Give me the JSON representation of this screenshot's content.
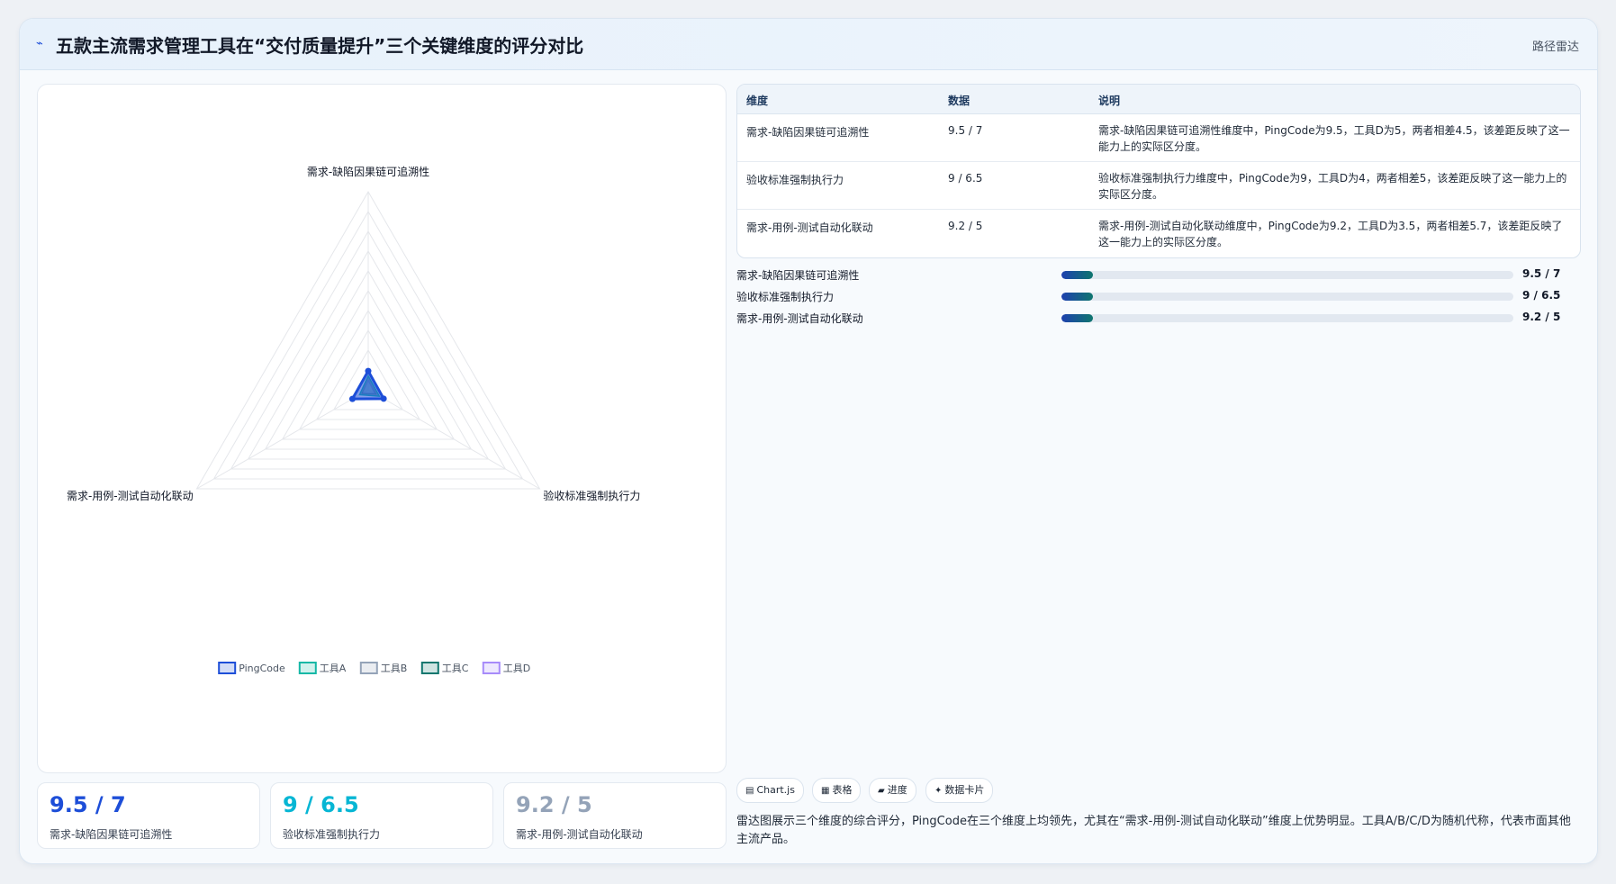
{
  "header": {
    "icon": "radar-icon",
    "title": "五款主流需求管理工具在“交付质量提升”三个关键维度的评分对比",
    "tag": "路径雷达"
  },
  "chart_data": {
    "type": "radar",
    "axes": [
      "需求-缺陷因果链可追溯性",
      "验收标准强制执行力",
      "需求-用例-测试自动化联动"
    ],
    "scale_max": 100,
    "grid_levels": 10,
    "series": [
      {
        "name": "PingCode",
        "values": [
          9.5,
          9,
          9.2
        ],
        "color": "#1d4ed8"
      },
      {
        "name": "工具A",
        "values": [
          7,
          6.5,
          5
        ],
        "color": "#14b8a6"
      },
      {
        "name": "工具B",
        "values": [
          6,
          5.5,
          4.5
        ],
        "color": "#94a3b8"
      },
      {
        "name": "工具C",
        "values": [
          6.5,
          5,
          4
        ],
        "color": "#0f766e"
      },
      {
        "name": "工具D",
        "values": [
          5,
          4,
          3.5
        ],
        "color": "#a78bfa"
      }
    ],
    "legend": "bottom",
    "grid": true
  },
  "table": {
    "headers": [
      "维度",
      "数据",
      "说明"
    ],
    "rows": [
      {
        "dim": "需求-缺陷因果链可追溯性",
        "data": "9.5 / 7",
        "desc": "需求-缺陷因果链可追溯性维度中，PingCode为9.5，工具D为5，两者相差4.5，该差距反映了这一能力上的实际区分度。"
      },
      {
        "dim": "验收标准强制执行力",
        "data": "9 / 6.5",
        "desc": "验收标准强制执行力维度中，PingCode为9，工具D为4，两者相差5，该差距反映了这一能力上的实际区分度。"
      },
      {
        "dim": "需求-用例-测试自动化联动",
        "data": "9.2 / 5",
        "desc": "需求-用例-测试自动化联动维度中，PingCode为9.2，工具D为3.5，两者相差5.7，该差距反映了这一能力上的实际区分度。"
      }
    ]
  },
  "progress": [
    {
      "label": "需求-缺陷因果链可追溯性",
      "value_text": "9.5 / 7",
      "fraction": 0.07
    },
    {
      "label": "验收标准强制执行力",
      "value_text": "9 / 6.5",
      "fraction": 0.07
    },
    {
      "label": "需求-用例-测试自动化联动",
      "value_text": "9.2 / 5",
      "fraction": 0.07
    }
  ],
  "kpis": [
    {
      "value": "9.5 / 7",
      "label": "需求-缺陷因果链可追溯性",
      "color": "#1d4ed8"
    },
    {
      "value": "9 / 6.5",
      "label": "验收标准强制执行力",
      "color": "#06b6d4"
    },
    {
      "value": "9.2 / 5",
      "label": "需求-用例-测试自动化联动",
      "color": "#94a3b8"
    }
  ],
  "chips": [
    {
      "icon": "▤",
      "label": "Chart.js"
    },
    {
      "icon": "▦",
      "label": "表格"
    },
    {
      "icon": "▰",
      "label": "进度"
    },
    {
      "icon": "✦",
      "label": "数据卡片"
    }
  ],
  "note": "雷达图展示三个维度的综合评分，PingCode在三个维度上均领先，尤其在“需求-用例-测试自动化联动”维度上优势明显。工具A/B/C/D为随机代称，代表市面其他主流产品。"
}
